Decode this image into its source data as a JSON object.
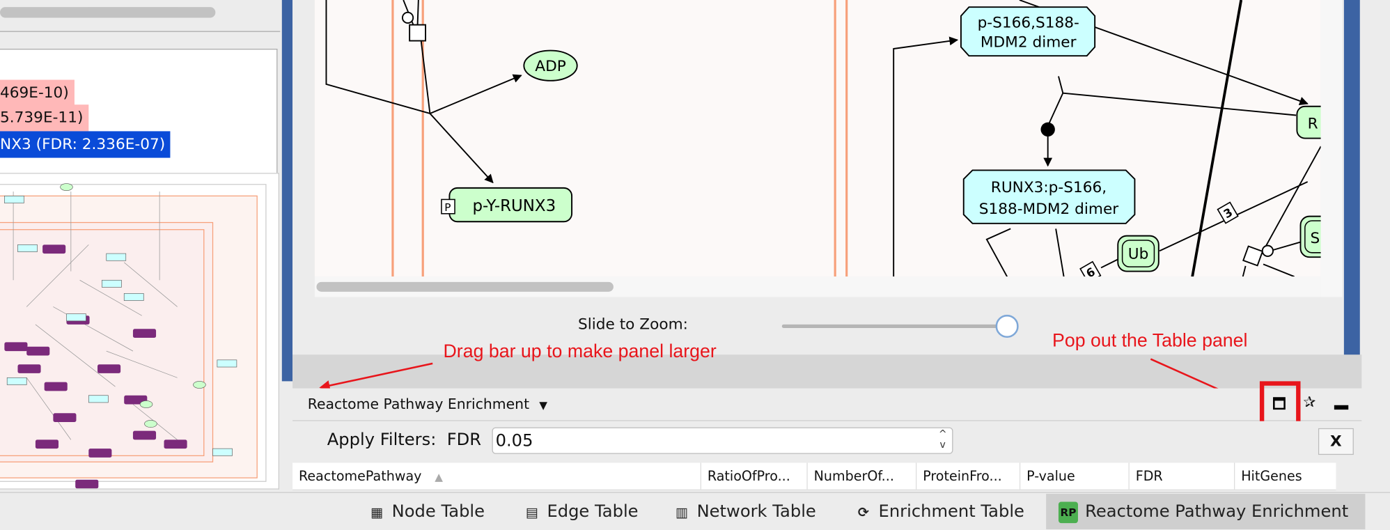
{
  "left_panel": {
    "enrichment_list": [
      {
        "text": "469E-10)",
        "highlight": "#ffb8b8"
      },
      {
        "text": "5.739E-11)",
        "highlight": "#ffb8b8"
      },
      {
        "text": "NX3 (FDR: 2.336E-07)",
        "highlight": "#0a4bd8",
        "selected": true
      }
    ]
  },
  "network": {
    "nodes": {
      "adp": "ADP",
      "p_y_runx3": "p-Y-RUNX3",
      "p_badge": "P",
      "mdm2_line1": "p-S166,S188-",
      "mdm2_line2": "MDM2 dimer",
      "runx3_line1": "RUNX3:p-S166,",
      "runx3_line2": "S188-MDM2 dimer",
      "ub": "Ub",
      "r_partial": "R",
      "s_partial": "S",
      "stoich_3": "3",
      "stoich_6": "6"
    },
    "colors": {
      "complex": "#ccffff",
      "protein": "#ccffcc",
      "compartment": "#f7a07a"
    }
  },
  "zoom": {
    "label": "Slide to Zoom:",
    "value_fraction": 1.0
  },
  "annotations": {
    "drag": "Drag bar up to make panel larger",
    "popout": "Pop out the Table panel",
    "color": "#e8151b"
  },
  "table_panel": {
    "title": "Reactome Pathway Enrichment",
    "filter_label": "Apply Filters:",
    "filter_field": "FDR",
    "filter_value": "0.05",
    "clear_label": "X",
    "columns": [
      "ReactomePathway",
      "RatioOfPro...",
      "NumberOf...",
      "ProteinFro...",
      "P-value",
      "FDR",
      "HitGenes"
    ]
  },
  "bottom_tabs": [
    {
      "label": "Node Table",
      "icon": "node-table-icon"
    },
    {
      "label": "Edge Table",
      "icon": "edge-table-icon"
    },
    {
      "label": "Network Table",
      "icon": "network-table-icon"
    },
    {
      "label": "Enrichment Table",
      "icon": "refresh-icon"
    },
    {
      "label": "Reactome Pathway Enrichment",
      "icon": "RP",
      "selected": true
    }
  ]
}
